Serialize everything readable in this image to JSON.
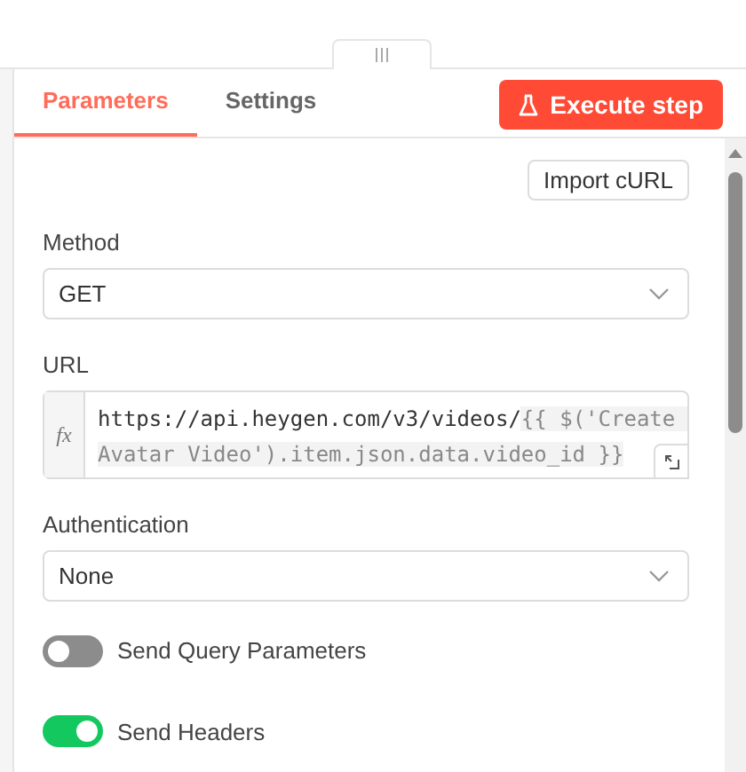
{
  "tabs": [
    {
      "label": "Parameters",
      "selected": true
    },
    {
      "label": "Settings",
      "selected": false
    }
  ],
  "execute_button": "Execute step",
  "import_button": "Import cURL",
  "fields": [
    {
      "kind": "select",
      "label": "Method",
      "value": "GET"
    },
    {
      "kind": "expression",
      "label": "URL",
      "segments": [
        {
          "kind": "text",
          "text": "https://api.heygen.com/v3/videos/"
        },
        {
          "kind": "expression",
          "text": "{{ $('Create Avatar Video').item.json.data.video_id }}"
        }
      ],
      "prefix": "fx"
    },
    {
      "kind": "select",
      "label": "Authentication",
      "value": "None"
    },
    {
      "kind": "toggle",
      "label": "Send Query Parameters",
      "on": false
    },
    {
      "kind": "toggle",
      "label": "Send Headers",
      "on": true
    }
  ]
}
